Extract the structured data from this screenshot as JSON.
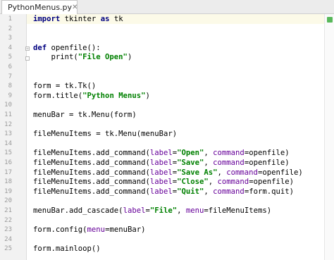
{
  "tab": {
    "filename": "PythonMenus.py",
    "close_glyph": "✕"
  },
  "line_numbers": [
    "1",
    "2",
    "3",
    "4",
    "5",
    "6",
    "7",
    "8",
    "9",
    "10",
    "11",
    "12",
    "13",
    "14",
    "15",
    "16",
    "17",
    "18",
    "19",
    "20",
    "21",
    "22",
    "23",
    "24",
    "25"
  ],
  "code": {
    "l1_kw_import": "import",
    "l1_mid": " tkinter ",
    "l1_kw_as": "as",
    "l1_end": " tk",
    "l4_kw_def": "def",
    "l4_rest": " openfile():",
    "l5_a": "    print(",
    "l5_str": "\"File Open\"",
    "l5_b": ")",
    "l8": "form = tk.Tk()",
    "l9_a": "form.title(",
    "l9_str": "\"Python Menus\"",
    "l9_b": ")",
    "l11": "menuBar = tk.Menu(form)",
    "l13": "fileMenuItems = tk.Menu(menuBar)",
    "add_prefix": "fileMenuItems.add_command(",
    "p_label": "label",
    "p_command": "command",
    "p_menu": "menu",
    "eq": "=",
    "sep": ", ",
    "close": ")",
    "s_open": "\"Open\"",
    "s_save": "\"Save\"",
    "s_saveas": "\"Save As\"",
    "s_close": "\"Close\"",
    "s_quit": "\"Quit\"",
    "v_openfile": "openfile",
    "v_formquit": "form.quit",
    "l21_a": "menuBar.add_cascade(",
    "s_file": "\"File\"",
    "v_filemenuitems": "fileMenuItems",
    "l23_a": "form.config(",
    "v_menubar": "menuBar",
    "l25": "form.mainloop()"
  },
  "colors": {
    "keyword": "#000080",
    "string": "#008000",
    "parameter": "#660099",
    "gutter_bg": "#f2f2f2",
    "line_number": "#9a9a9a"
  },
  "icons": {
    "tab": "python-file-icon",
    "fold_start": "fold-open-icon",
    "fold_end": "fold-end-icon",
    "inspection": "inspection-ok-icon"
  }
}
